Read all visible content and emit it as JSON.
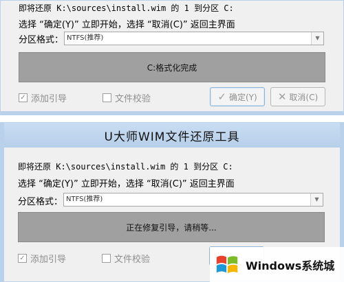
{
  "top": {
    "line1": "即将还原 K:\\sources\\install.wim 的 1 到分区 C:",
    "line2": "选择 “确定(Y)” 立即开始，选择 “取消(C)” 返回主界面",
    "partition_label": "分区格式：",
    "partition_value": "NTFS(推荐)",
    "progress_text": "C:格式化完成",
    "add_boot_label": "添加引导",
    "file_verify_label": "文件校验",
    "ok_label": "确定(Y)",
    "cancel_label": "取消(C)"
  },
  "bottom": {
    "title": "U大师WIM文件还原工具",
    "line1": "即将还原 K:\\sources\\install.wim 的 1 到分区 C:",
    "line2": "选择 “确定(Y)” 立即开始，选择 “取消(C)” 返回主界面",
    "partition_label": "分区格式：",
    "partition_value": "NTFS(推荐)",
    "progress_text": "正在修复引导，请稍等...",
    "add_boot_label": "添加引导",
    "file_verify_label": "文件校验"
  },
  "watermark": {
    "text": "Windows系统城"
  },
  "icons": {
    "check": "checkmark-icon",
    "cross": "cross-icon",
    "arrow": "dropdown-arrow-icon",
    "logo": "windows-logo-icon"
  },
  "colors": {
    "titlebar": "#b9d1ea",
    "progress": "#a0a0a0",
    "disabled_text": "#8e8e8e"
  }
}
